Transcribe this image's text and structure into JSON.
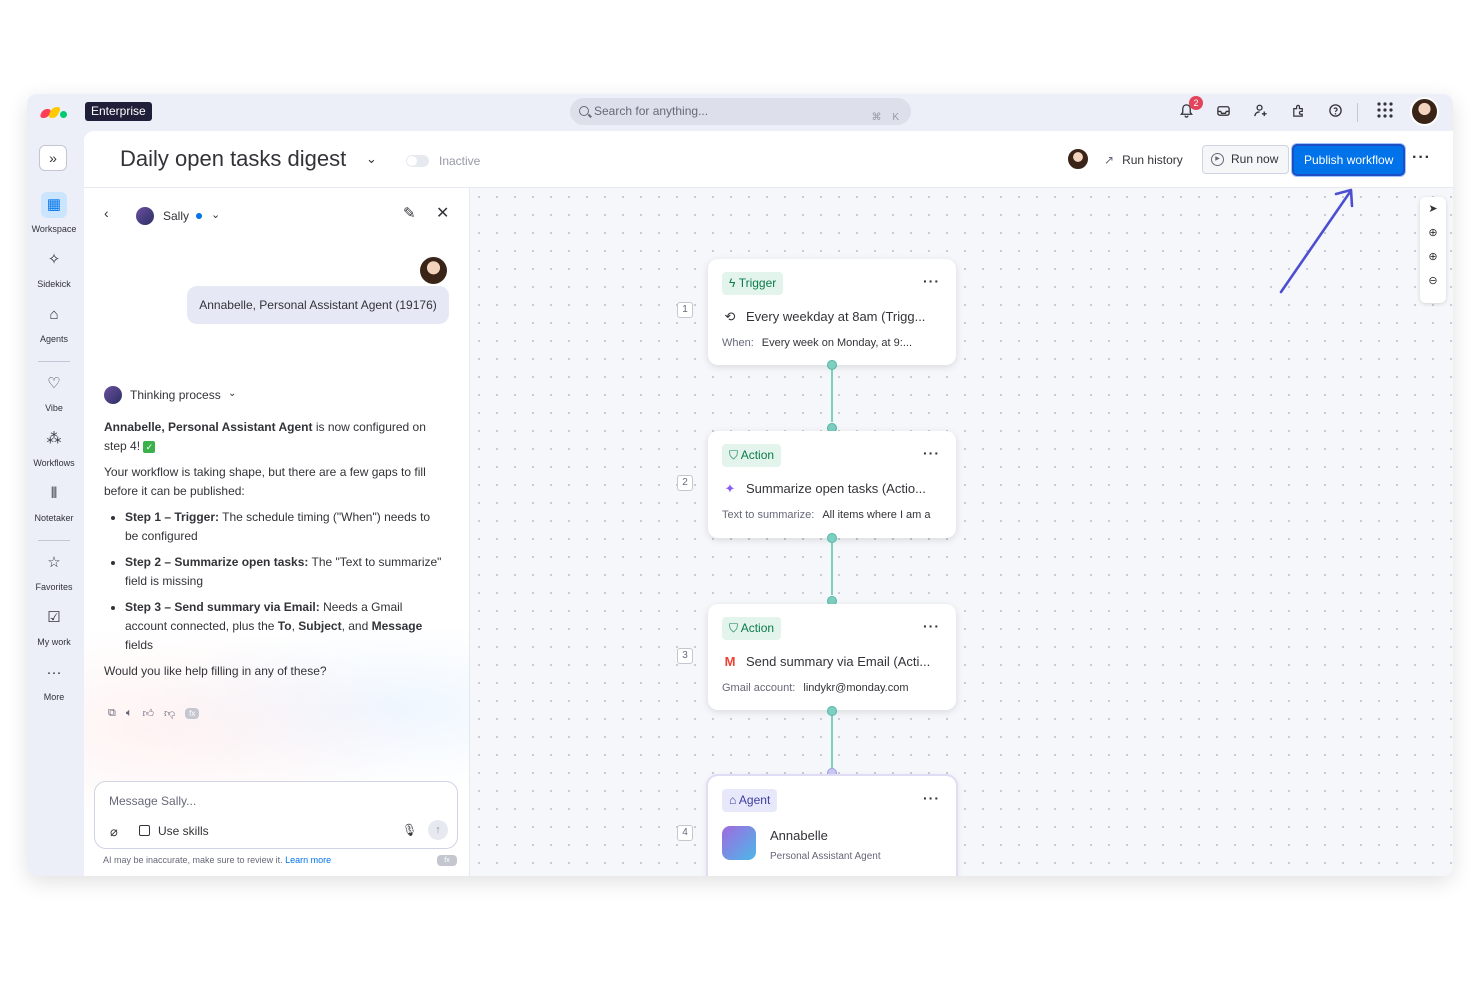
{
  "topbar": {
    "plan_badge": "Enterprise",
    "search_placeholder": "Search for anything...",
    "search_shortcut": "⌘ K",
    "notifications_count": "2",
    "colors": {
      "logo": [
        "#ff3d57",
        "#ffcb00",
        "#00ca72"
      ],
      "accent": "#0073ea"
    }
  },
  "sidebar": {
    "items": [
      {
        "label": "Workspace",
        "icon": "grid-icon",
        "active": true
      },
      {
        "label": "Sidekick",
        "icon": "sparkle-icon"
      },
      {
        "label": "Agents",
        "icon": "agent-icon"
      },
      {
        "label": "Vibe",
        "icon": "heart-icon"
      },
      {
        "label": "Workflows",
        "icon": "workflow-icon"
      },
      {
        "label": "Notetaker",
        "icon": "waveform-icon"
      },
      {
        "label": "Favorites",
        "icon": "star-icon"
      },
      {
        "label": "My work",
        "icon": "calendar-check-icon"
      },
      {
        "label": "More",
        "icon": "more-dots-icon"
      }
    ]
  },
  "header": {
    "title": "Daily open tasks digest",
    "status": "Inactive",
    "run_history": "Run history",
    "run_now": "Run now",
    "publish": "Publish workflow"
  },
  "chat": {
    "agent_name": "Sally",
    "user_message": "Annabelle, Personal Assistant Agent (19176)",
    "thinking_label": "Thinking process",
    "intro_bold": "Annabelle, Personal Assistant Agent",
    "intro_rest": " is now configured on step 4!",
    "summary": "Your workflow is taking shape, but there are a few gaps to fill before it can be published:",
    "gaps": [
      {
        "bold": "Step 1 – Trigger:",
        "text": " The schedule timing (\"When\") needs to be configured"
      },
      {
        "bold": "Step 2 – Summarize open tasks:",
        "text": " The \"Text to summarize\" field is missing"
      },
      {
        "bold": "Step 3 – Send summary via Email:",
        "text": " Needs a Gmail account connected, plus the ",
        "b2": "To",
        "t2": ", ",
        "b3": "Subject",
        "t3": ", and ",
        "b4": "Message",
        "t4": " fields"
      }
    ],
    "question": "Would you like help filling in any of these?",
    "fx_badge": "fx",
    "composer_placeholder": "Message Sally...",
    "use_skills": "Use skills",
    "disclaimer": "AI may be inaccurate, make sure to review it.",
    "learn_more": "Learn more"
  },
  "workflow": {
    "steps": [
      {
        "number": "1",
        "tag": "Trigger",
        "title": "Every weekday at 8am (Trigg...",
        "field_label": "When:",
        "field_value": "Every week on Monday, at 9:..."
      },
      {
        "number": "2",
        "tag": "Action",
        "title": "Summarize open tasks (Actio...",
        "field_label": "Text to summarize:",
        "field_value": "All items where I am a"
      },
      {
        "number": "3",
        "tag": "Action",
        "title": "Send summary via Email (Acti...",
        "field_label": "Gmail account:",
        "field_value": "lindykr@monday.com"
      },
      {
        "number": "4",
        "tag": "Agent",
        "title": "Annabelle",
        "subtitle": "Personal Assistant Agent"
      }
    ]
  }
}
